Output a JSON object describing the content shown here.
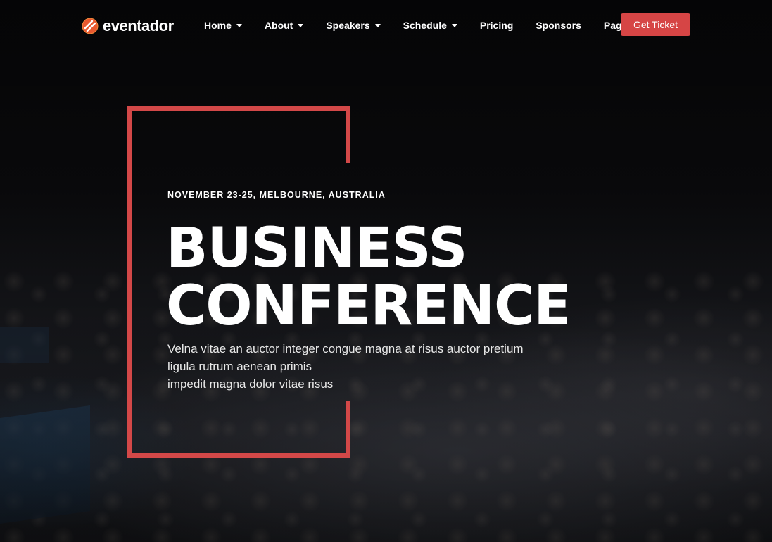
{
  "brand": {
    "name": "eventador",
    "accent_color": "#d64545",
    "logo_icon": "flame-logo-icon"
  },
  "nav": {
    "items": [
      {
        "label": "Home",
        "has_dropdown": true
      },
      {
        "label": "About",
        "has_dropdown": true
      },
      {
        "label": "Speakers",
        "has_dropdown": true
      },
      {
        "label": "Schedule",
        "has_dropdown": true
      },
      {
        "label": "Pricing",
        "has_dropdown": false
      },
      {
        "label": "Sponsors",
        "has_dropdown": false
      },
      {
        "label": "Pages",
        "has_dropdown": true
      }
    ],
    "cta_label": "Get Ticket"
  },
  "hero": {
    "eyebrow": "NOVEMBER 23-25, MELBOURNE, AUSTRALIA",
    "title_line1": "BUSINESS",
    "title_line2": "CONFERENCE",
    "description_lines": [
      "Velna vitae an auctor integer congue magna at risus auctor pretium",
      "ligula rutrum aenean primis",
      "impedit magna dolor vitae risus"
    ],
    "frame_color": "#d34848"
  }
}
